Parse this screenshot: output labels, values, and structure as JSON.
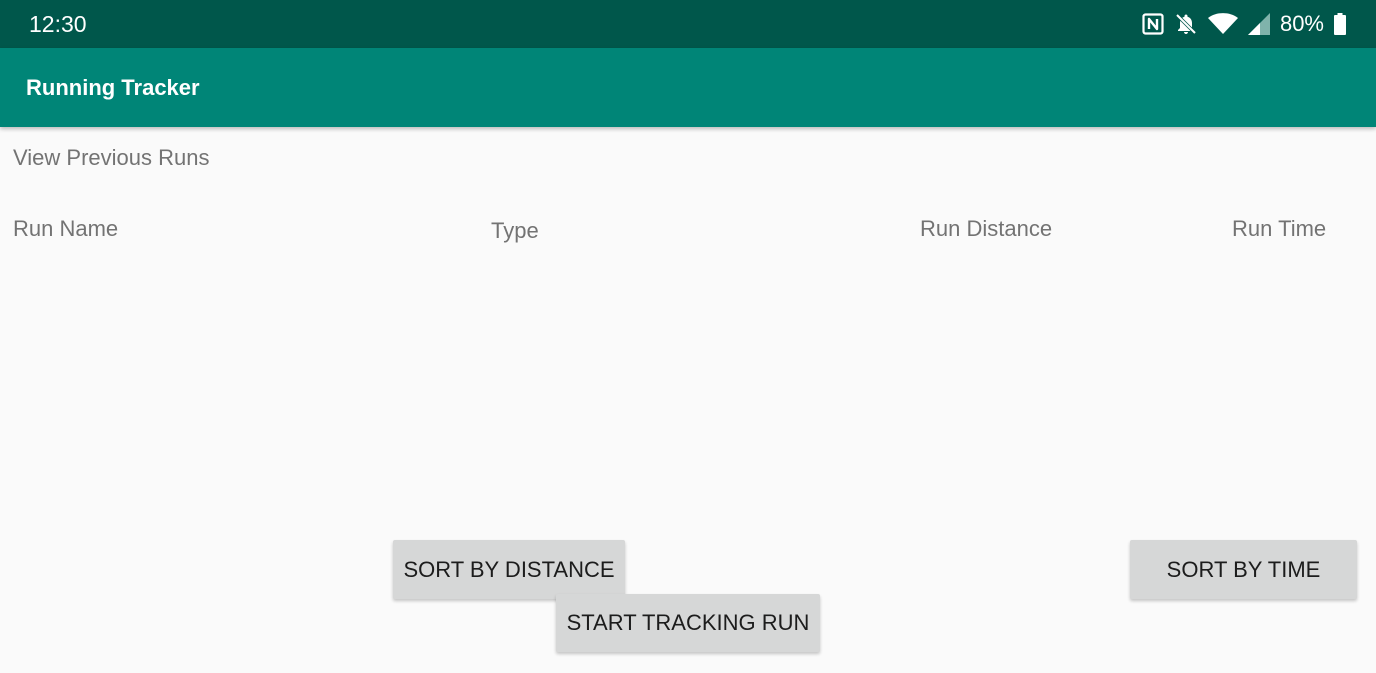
{
  "status_bar": {
    "time": "12:30",
    "battery": "80%",
    "icons": [
      "nfc-icon",
      "notifications-off-icon",
      "wifi-icon",
      "cell-signal-icon",
      "battery-icon"
    ]
  },
  "app_bar": {
    "title": "Running Tracker"
  },
  "main": {
    "section_title": "View Previous Runs",
    "columns": [
      "Run Name",
      "Type",
      "Run Distance",
      "Run Time"
    ],
    "runs": []
  },
  "buttons": {
    "sort_distance": "SORT BY DISTANCE",
    "start_tracking": "START TRACKING RUN",
    "sort_time": "SORT BY TIME"
  },
  "colors": {
    "status_bar": "#00574b",
    "app_bar": "#008577",
    "background": "#fafafa",
    "button": "#d6d7d7",
    "secondary_text": "#737373"
  }
}
